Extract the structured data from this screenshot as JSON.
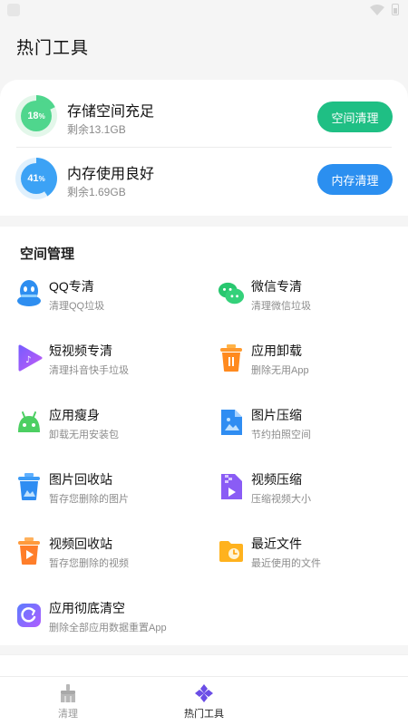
{
  "page": {
    "title": "热门工具"
  },
  "status": [
    {
      "percent_label": "18",
      "percent_unit": "%",
      "percent_value": 18,
      "title": "存储空间充足",
      "subtitle": "剩余13.1GB",
      "button": "空间清理",
      "color": "#1fbf84",
      "ring_color": "#4fd68d"
    },
    {
      "percent_label": "41",
      "percent_unit": "%",
      "percent_value": 41,
      "title": "内存使用良好",
      "subtitle": "剩余1.69GB",
      "button": "内存清理",
      "color": "#2b8ff0",
      "ring_color": "#3ca2f5"
    }
  ],
  "space": {
    "title": "空间管理",
    "tools": [
      {
        "name": "QQ专清",
        "desc": "清理QQ垃圾",
        "icon": "qq-penguin-icon"
      },
      {
        "name": "微信专清",
        "desc": "清理微信垃圾",
        "icon": "wechat-icon"
      },
      {
        "name": "短视频专清",
        "desc": "清理抖音快手垃圾",
        "icon": "short-video-icon"
      },
      {
        "name": "应用卸载",
        "desc": "删除无用App",
        "icon": "trash-icon"
      },
      {
        "name": "应用瘦身",
        "desc": "卸载无用安装包",
        "icon": "android-icon"
      },
      {
        "name": "图片压缩",
        "desc": "节约拍照空间",
        "icon": "image-compress-icon"
      },
      {
        "name": "图片回收站",
        "desc": "暂存您删除的图片",
        "icon": "image-recycle-icon"
      },
      {
        "name": "视频压缩",
        "desc": "压缩视频大小",
        "icon": "video-compress-icon"
      },
      {
        "name": "视频回收站",
        "desc": "暂存您删除的视频",
        "icon": "video-recycle-icon"
      },
      {
        "name": "最近文件",
        "desc": "最近使用的文件",
        "icon": "recent-folder-icon"
      },
      {
        "name": "应用彻底清空",
        "desc": "删除全部应用数据重置App",
        "icon": "app-reset-icon"
      }
    ]
  },
  "tabs": [
    {
      "label": "清理",
      "icon": "broom-icon"
    },
    {
      "label": "热门工具",
      "icon": "grid-flower-icon"
    }
  ],
  "colors": {
    "accent_green": "#1fbf84",
    "accent_blue": "#2b8ff0",
    "tab_active": "#6b4ee6"
  }
}
